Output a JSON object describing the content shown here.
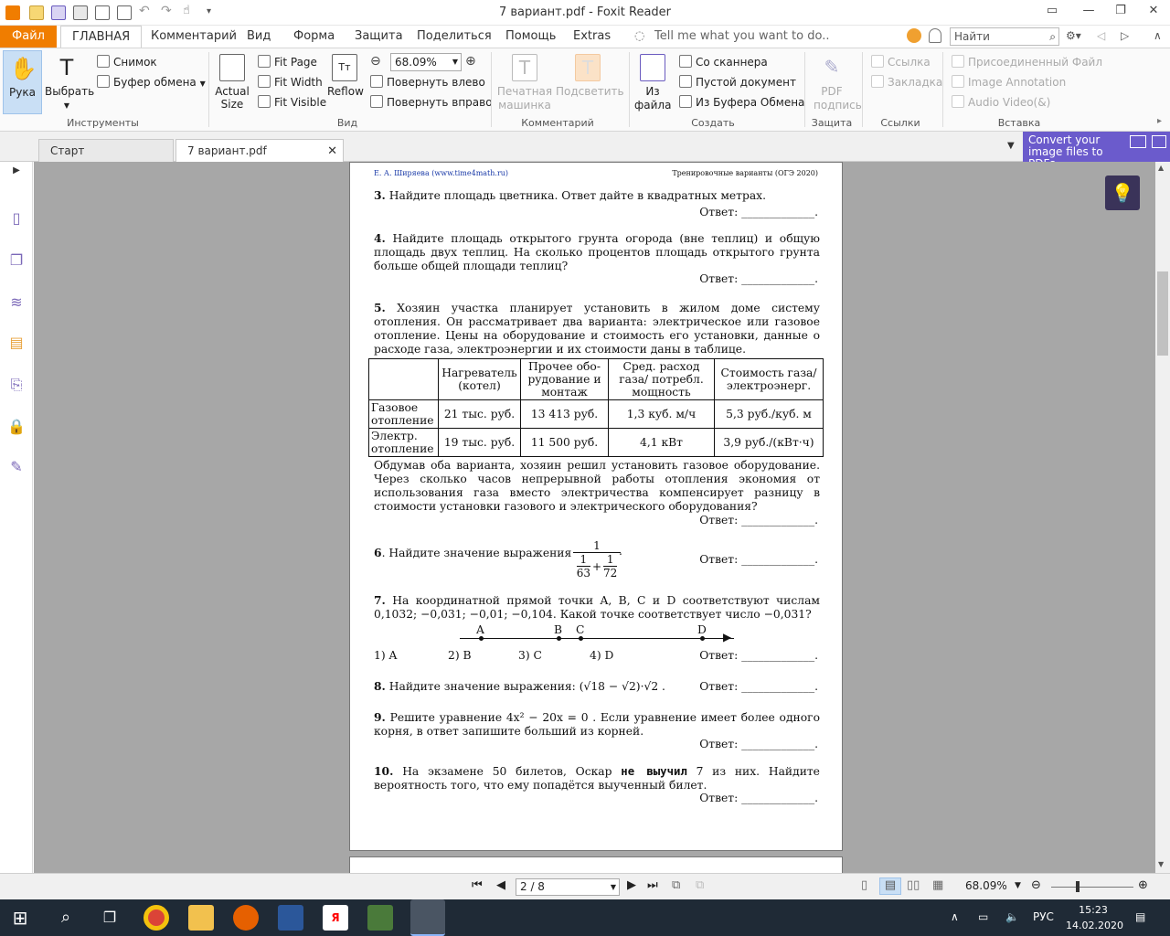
{
  "window": {
    "title": "7 вариант.pdf - Foxit Reader"
  },
  "menu": {
    "file": "Файл",
    "tabs": [
      "ГЛАВНАЯ",
      "Комментарий",
      "Вид",
      "Форма",
      "Защита",
      "Поделиться",
      "Помощь",
      "Extras"
    ],
    "tell_me": "Tell me what you want to do..",
    "search_placeholder": "Найти"
  },
  "ribbon": {
    "tools": {
      "hand": "Рука",
      "select": "Выбрать",
      "snapshot": "Снимок",
      "clipboard": "Буфер обмена",
      "label": "Инструменты"
    },
    "view": {
      "actual_size": "Actual Size",
      "fit_page": "Fit Page",
      "fit_width": "Fit Width",
      "fit_visible": "Fit Visible",
      "reflow": "Reflow",
      "zoom": "68.09%",
      "rotate_left": "Повернуть влево",
      "rotate_right": "Повернуть вправо",
      "label": "Вид"
    },
    "comment": {
      "typewriter": "Печатная машинка",
      "highlight": "Подсветить",
      "label": "Комментарий"
    },
    "create": {
      "from_file": "Из файла",
      "from_scanner": "Со сканнера",
      "blank": "Пустой документ",
      "from_clipboard": "Из Буфера Обмена",
      "label": "Создать"
    },
    "protect": {
      "sign": "PDF подпись",
      "label": "Защита"
    },
    "links": {
      "link": "Ссылка",
      "bookmark": "Закладка",
      "label": "Ссылки"
    },
    "insert": {
      "attached_file": "Присоединенный Файл",
      "image_annotation": "Image Annotation",
      "audio_video": "Audio  Video(&)",
      "label": "Вставка"
    }
  },
  "tabs": {
    "start": "Старт",
    "doc": "7 вариант.pdf",
    "promo": "Convert your image files to PDFs"
  },
  "pdf": {
    "header_left": "Е. А. Ширяева (www.time4math.ru)",
    "header_right": "Тренировочные варианты (ОГЭ 2020)",
    "answer_label": "Ответ: _____________.",
    "q3": {
      "num": "3.",
      "text": "Найдите площадь цветника. Ответ дайте в квадратных метрах."
    },
    "q4": {
      "num": "4.",
      "text": "Найдите площадь открытого грунта огорода (вне теплиц) и общую площадь двух теплиц. На сколько процентов площадь открытого грунта больше общей площади теплиц?"
    },
    "q5": {
      "num": "5.",
      "text": "Хозяин участка планирует установить в жилом доме систему отопления. Он рассматривает два варианта: электрическое или газовое отопление. Цены на оборудование и стоимость его установки, данные о расходе газа, электроэнергии и их стоимости даны в таблице.",
      "after": "Обдумав оба варианта, хозяин решил установить газовое оборудование. Через сколько часов непрерывной работы отопления экономия от использования газа вместо электричества компенсирует разницу в стоимости установки газового и электрического оборудования?"
    },
    "table": {
      "headers": [
        "",
        "Нагреватель (котел)",
        "Прочее обо-рудование и монтаж",
        "Сред. расход газа/ потребл. мощность",
        "Стоимость газа/электроэнерг."
      ],
      "rows": [
        [
          "Газовое отопление",
          "21 тыс. руб.",
          "13 413 руб.",
          "1,3 куб. м/ч",
          "5,3 руб./куб. м"
        ],
        [
          "Электр. отопление",
          "19 тыс. руб.",
          "11 500 руб.",
          "4,1 кВт",
          "3,9 руб./(кВт·ч)"
        ]
      ]
    },
    "q6": {
      "num": "6",
      "text": ". Найдите значение выражения",
      "frac_num": "1",
      "f1n": "1",
      "f1d": "63",
      "f2n": "1",
      "f2d": "72"
    },
    "q7": {
      "num": "7.",
      "text": "На координатной прямой точки A, B, C и D соответствуют числам 0,1032; −0,031; −0,01; −0,104. Какой точке соответствует число −0,031?",
      "points": [
        "A",
        "B",
        "C",
        "D"
      ],
      "options": [
        "1) A",
        "2) B",
        "3) C",
        "4) D"
      ]
    },
    "q8": {
      "num": "8.",
      "text": "Найдите значение выражения:",
      "expr": "(√18 − √2)·√2 ."
    },
    "q9": {
      "num": "9.",
      "text": "Решите уравнение 4x² − 20x = 0 . Если уравнение имеет более одного корня, в ответ запишите больший из корней."
    },
    "q10": {
      "num": "10.",
      "text_a": "На экзамене 50 билетов, Оскар",
      "bold": "не выучил",
      "text_b": "7 из них. Найдите вероятность того, что ему попадётся выученный билет."
    }
  },
  "status": {
    "page": "2 / 8",
    "zoom": "68.09%"
  },
  "taskbar": {
    "time": "15:23",
    "date": "14.02.2020",
    "lang": "РУС"
  }
}
